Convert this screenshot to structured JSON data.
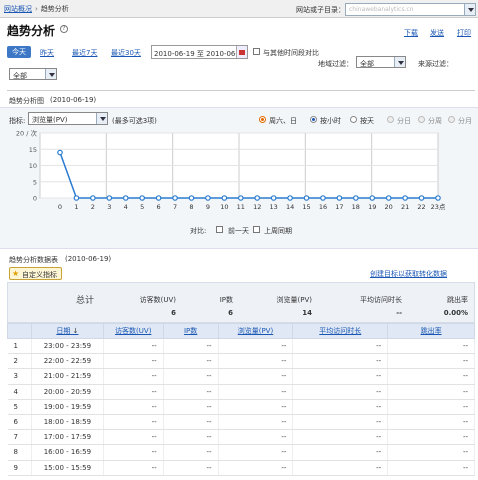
{
  "breadcrumb": {
    "home": "网站概况",
    "sep": "›",
    "current": "趋势分析"
  },
  "site_filter": {
    "label": "网站或子目录：",
    "value": "chinawebanalytics.cn"
  },
  "page_title": "趋势分析",
  "help_glyph": "?",
  "actions": {
    "download": "下载",
    "send": "发送",
    "print": "打印"
  },
  "quick_ranges": {
    "today": "今天",
    "yesterday": "昨天",
    "last7": "最近7天",
    "last30": "最近30天"
  },
  "date_range": "2010-06-19 至 2010-06-19",
  "compare_label": "与其他时间段对比",
  "region_filter": {
    "label": "地域过滤：",
    "value": "全部"
  },
  "source_filter": {
    "label": "来源过滤：",
    "value": "全部"
  },
  "chart_section": {
    "title": "趋势分析图",
    "date": "(2010-06-19)",
    "metric_label": "指标:",
    "metric_value": "浏览量(PV)",
    "metric_hint": "(最多可选3项)",
    "weekend": "周六、日",
    "by_hour": "按小时",
    "by_day": "按天",
    "by_day2": "分日",
    "by_week": "分周",
    "by_month": "分月",
    "compare_label": "对比:",
    "compare_prev": "前一天",
    "compare_lastweek": "上周同期"
  },
  "chart_data": {
    "type": "line",
    "x": [
      0,
      1,
      2,
      3,
      4,
      5,
      6,
      7,
      8,
      9,
      10,
      11,
      12,
      13,
      14,
      15,
      16,
      17,
      18,
      19,
      20,
      21,
      22,
      23
    ],
    "series": [
      {
        "values": [
          14,
          0,
          0,
          0,
          0,
          0,
          0,
          0,
          0,
          0,
          0,
          0,
          0,
          0,
          0,
          0,
          0,
          0,
          0,
          0,
          0,
          0,
          0,
          0
        ]
      }
    ],
    "y_ticks": [
      0,
      5,
      10,
      15,
      20
    ],
    "y_unit": "次",
    "x_tick_labels": [
      "0",
      "1",
      "2",
      "3",
      "4",
      "5",
      "6",
      "7",
      "8",
      "9",
      "10",
      "11",
      "12",
      "13",
      "14",
      "15",
      "16",
      "17",
      "18",
      "19",
      "20",
      "21",
      "22",
      "23点"
    ],
    "ylim": [
      0,
      20
    ],
    "grid": true,
    "color": "#2a7bd0"
  },
  "table_section": {
    "title": "趋势分析数据表",
    "date": "(2010-06-19)",
    "customize": "自定义指标",
    "star_glyph": "★",
    "goal_link": "创建目标以获取转化数据"
  },
  "summary": {
    "label": "总计",
    "uv_label": "访客数(UV)",
    "uv": "6",
    "ip_label": "IP数",
    "ip": "6",
    "pv_label": "浏览量(PV)",
    "pv": "14",
    "avg_label": "平均访问时长",
    "avg": "--",
    "bounce_label": "跳出率",
    "bounce": "0.00%"
  },
  "columns": {
    "date": "日期",
    "sort_arrow": "↓",
    "uv": "访客数(UV)",
    "ip": "IP数",
    "pv": "浏览量(PV)",
    "avg": "平均访问时长",
    "bounce": "跳出率"
  },
  "rows": [
    {
      "n": "1",
      "range": "23:00 - 23:59",
      "uv": "--",
      "ip": "--",
      "pv": "--",
      "avg": "--",
      "bounce": "--"
    },
    {
      "n": "2",
      "range": "22:00 - 22:59",
      "uv": "--",
      "ip": "--",
      "pv": "--",
      "avg": "--",
      "bounce": "--"
    },
    {
      "n": "3",
      "range": "21:00 - 21:59",
      "uv": "--",
      "ip": "--",
      "pv": "--",
      "avg": "--",
      "bounce": "--"
    },
    {
      "n": "4",
      "range": "20:00 - 20:59",
      "uv": "--",
      "ip": "--",
      "pv": "--",
      "avg": "--",
      "bounce": "--"
    },
    {
      "n": "5",
      "range": "19:00 - 19:59",
      "uv": "--",
      "ip": "--",
      "pv": "--",
      "avg": "--",
      "bounce": "--"
    },
    {
      "n": "6",
      "range": "18:00 - 18:59",
      "uv": "--",
      "ip": "--",
      "pv": "--",
      "avg": "--",
      "bounce": "--"
    },
    {
      "n": "7",
      "range": "17:00 - 17:59",
      "uv": "--",
      "ip": "--",
      "pv": "--",
      "avg": "--",
      "bounce": "--"
    },
    {
      "n": "8",
      "range": "16:00 - 16:59",
      "uv": "--",
      "ip": "--",
      "pv": "--",
      "avg": "--",
      "bounce": "--"
    },
    {
      "n": "9",
      "range": "15:00 - 15:59",
      "uv": "--",
      "ip": "--",
      "pv": "--",
      "avg": "--",
      "bounce": "--"
    }
  ]
}
